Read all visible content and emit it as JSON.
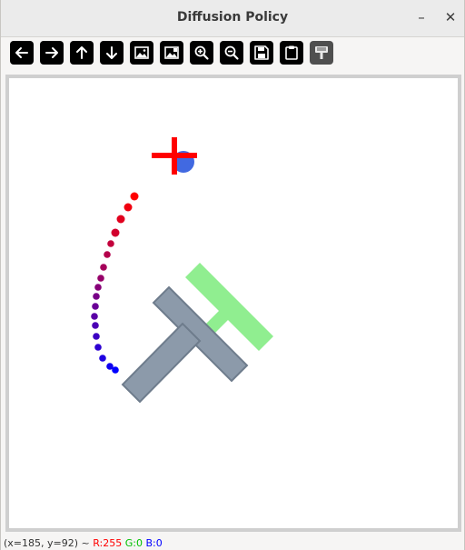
{
  "window": {
    "title": "Diffusion Policy",
    "minimize_label": "–",
    "close_label": "✕"
  },
  "toolbar": {
    "buttons": [
      {
        "name": "pan-left",
        "icon": "arrow-left-icon"
      },
      {
        "name": "pan-right",
        "icon": "arrow-right-icon"
      },
      {
        "name": "pan-up",
        "icon": "arrow-up-icon"
      },
      {
        "name": "pan-down",
        "icon": "arrow-down-icon"
      },
      {
        "name": "zoom-image",
        "icon": "image-icon"
      },
      {
        "name": "zoom-image-fit",
        "icon": "image-fit-icon"
      },
      {
        "name": "zoom-in",
        "icon": "zoom-in-icon"
      },
      {
        "name": "zoom-out",
        "icon": "zoom-out-icon"
      },
      {
        "name": "save",
        "icon": "save-icon"
      },
      {
        "name": "copy",
        "icon": "clipboard-icon"
      },
      {
        "name": "properties",
        "icon": "brush-icon"
      }
    ]
  },
  "scene": {
    "colors": {
      "t_block": "#8c9aaa",
      "t_block_border": "#6e7c8c",
      "goal": "#90ee90",
      "agent": "#4169e1",
      "target_cross": "#ff0000",
      "trajectory_start": "#0000ff",
      "trajectory_end": "#ff0000"
    }
  },
  "status": {
    "coords": "(x=185, y=92) ~",
    "r": "R:255",
    "g": "G:0",
    "b": "B:0"
  }
}
